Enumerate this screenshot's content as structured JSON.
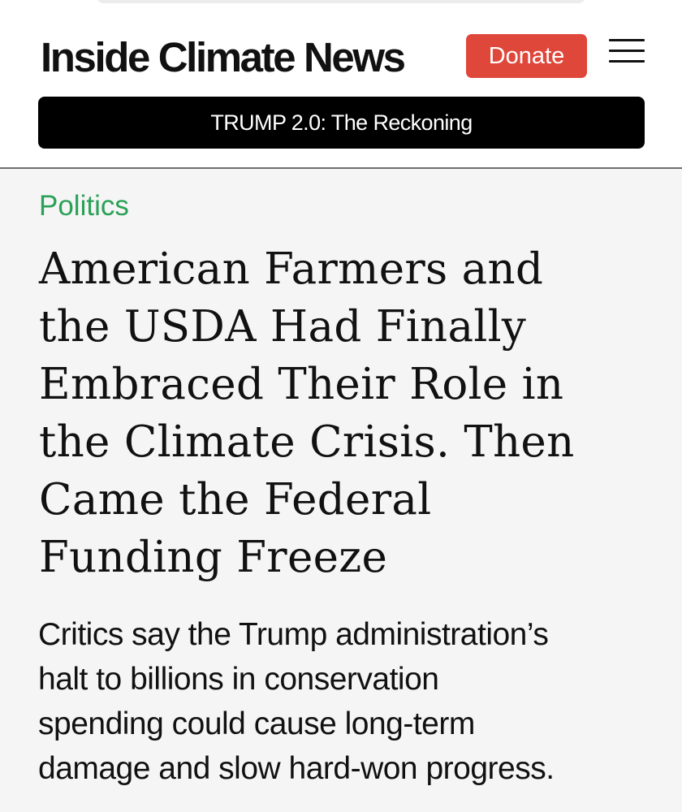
{
  "header": {
    "site_title": "Inside Climate News",
    "donate_label": "Donate",
    "menu_icon": "hamburger-menu-icon",
    "banner_label": "TRUMP 2.0: The Reckoning"
  },
  "article": {
    "category": "Politics",
    "headline_lines": [
      "American Farmers and",
      "the USDA Had Finally",
      "Embraced Their Role in",
      "the Climate Crisis. Then",
      "Came the Federal",
      "Funding Freeze"
    ],
    "dek_lines": [
      "Critics say the Trump administration’s",
      "halt to billions in conservation",
      "spending could cause long-term",
      "damage and slow hard-won progress."
    ]
  },
  "colors": {
    "donate_background": "#e0473b",
    "category_text": "#2aa156",
    "banner_background": "#000000",
    "page_background": "#f5f5f5",
    "header_background": "#ffffff"
  }
}
